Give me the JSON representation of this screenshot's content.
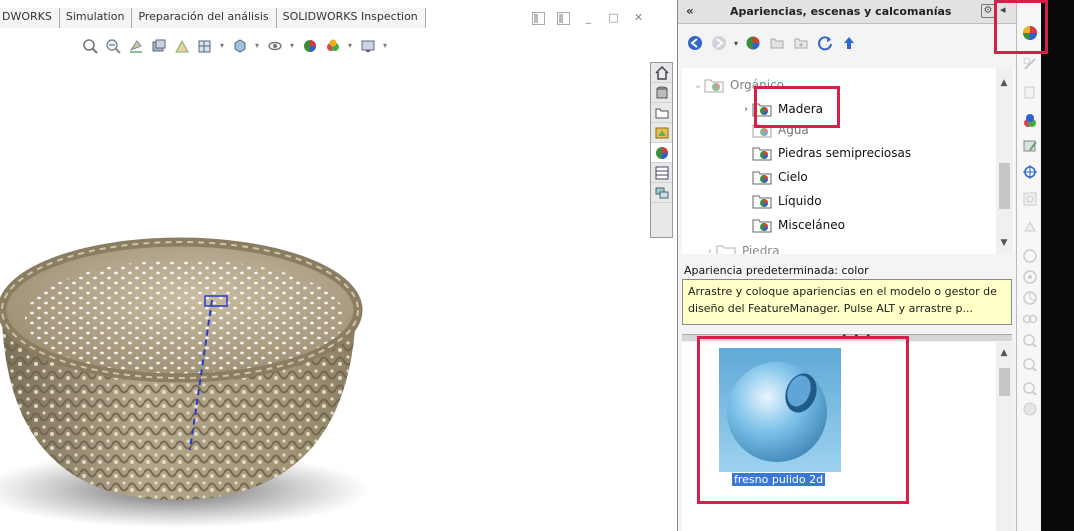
{
  "command_manager": {
    "tabs": [
      "DWORKS",
      "Simulation",
      "Preparación del análisis",
      "SOLIDWORKS Inspection"
    ]
  },
  "window_controls": [
    "restore-icon",
    "tile-icon",
    "minimize-icon",
    "maximize-icon",
    "close-icon"
  ],
  "heads_up_toolbar": [
    "zoom-to-fit-icon",
    "zoom-area-icon",
    "previous-view-icon",
    "section-view-icon",
    "dynamic-annotation-icon",
    "view-orientation-icon",
    "display-style-icon",
    "hide-show-icon",
    "edit-appearance-icon",
    "apply-scene-icon",
    "view-settings-icon"
  ],
  "model": {
    "name": "basket-model",
    "axis_color": "#2a3ad0",
    "body_color": "#b3a68a"
  },
  "task_pane_tabs": [
    "home-icon",
    "design-library-icon",
    "file-explorer-icon",
    "view-palette-icon",
    "appearances-icon",
    "custom-properties-icon",
    "forum-icon"
  ],
  "panel": {
    "title": "Apariencias, escenas y calcomanías",
    "collapse_label": "«",
    "options_label": "⚙",
    "pin_label": "◂",
    "toolbar": [
      "back-icon",
      "forward-icon",
      "appearance-icon",
      "add-folder-icon",
      "new-folder-icon",
      "refresh-icon",
      "up-icon"
    ],
    "tree": [
      {
        "label": "Orgánico",
        "expander": "⌄",
        "level": 0,
        "state": "partially-hidden"
      },
      {
        "label": "Madera",
        "expander": "›",
        "level": 1,
        "state": "highlighted"
      },
      {
        "label": "Agua",
        "expander": "",
        "level": 1,
        "state": "partially-hidden"
      },
      {
        "label": "Piedras semipreciosas",
        "expander": "",
        "level": 1,
        "state": "normal"
      },
      {
        "label": "Cielo",
        "expander": "",
        "level": 1,
        "state": "normal"
      },
      {
        "label": "Líquido",
        "expander": "",
        "level": 1,
        "state": "normal"
      },
      {
        "label": "Misceláneo",
        "expander": "",
        "level": 1,
        "state": "normal"
      },
      {
        "label": "Piedra",
        "expander": "›",
        "level": 0,
        "state": "partially-hidden"
      }
    ],
    "status_label": "Apariencia predeterminada: color",
    "hint": "Arrastre y coloque apariencias en el modelo o gestor de diseño del FeatureManager. Pulse ALT y arrastre p...",
    "splitter_dots": "• • •",
    "thumbnail": {
      "label": "fresno pulido 2d",
      "sphere_color": "#7cc1e8"
    }
  },
  "right_toolbar": [
    "appearances-icon",
    "sketch-icon",
    "copy-icon",
    "apply-appearance-icon",
    "edit-icon",
    "move-icon",
    "zoom-icon",
    "paste-icon",
    "rotate-icon",
    "view-icon",
    "render-icon",
    "link-icon",
    "hide-icon",
    "hide-icon",
    "hide-icon",
    "hide-icon"
  ],
  "highlight_color": "#d6204a"
}
